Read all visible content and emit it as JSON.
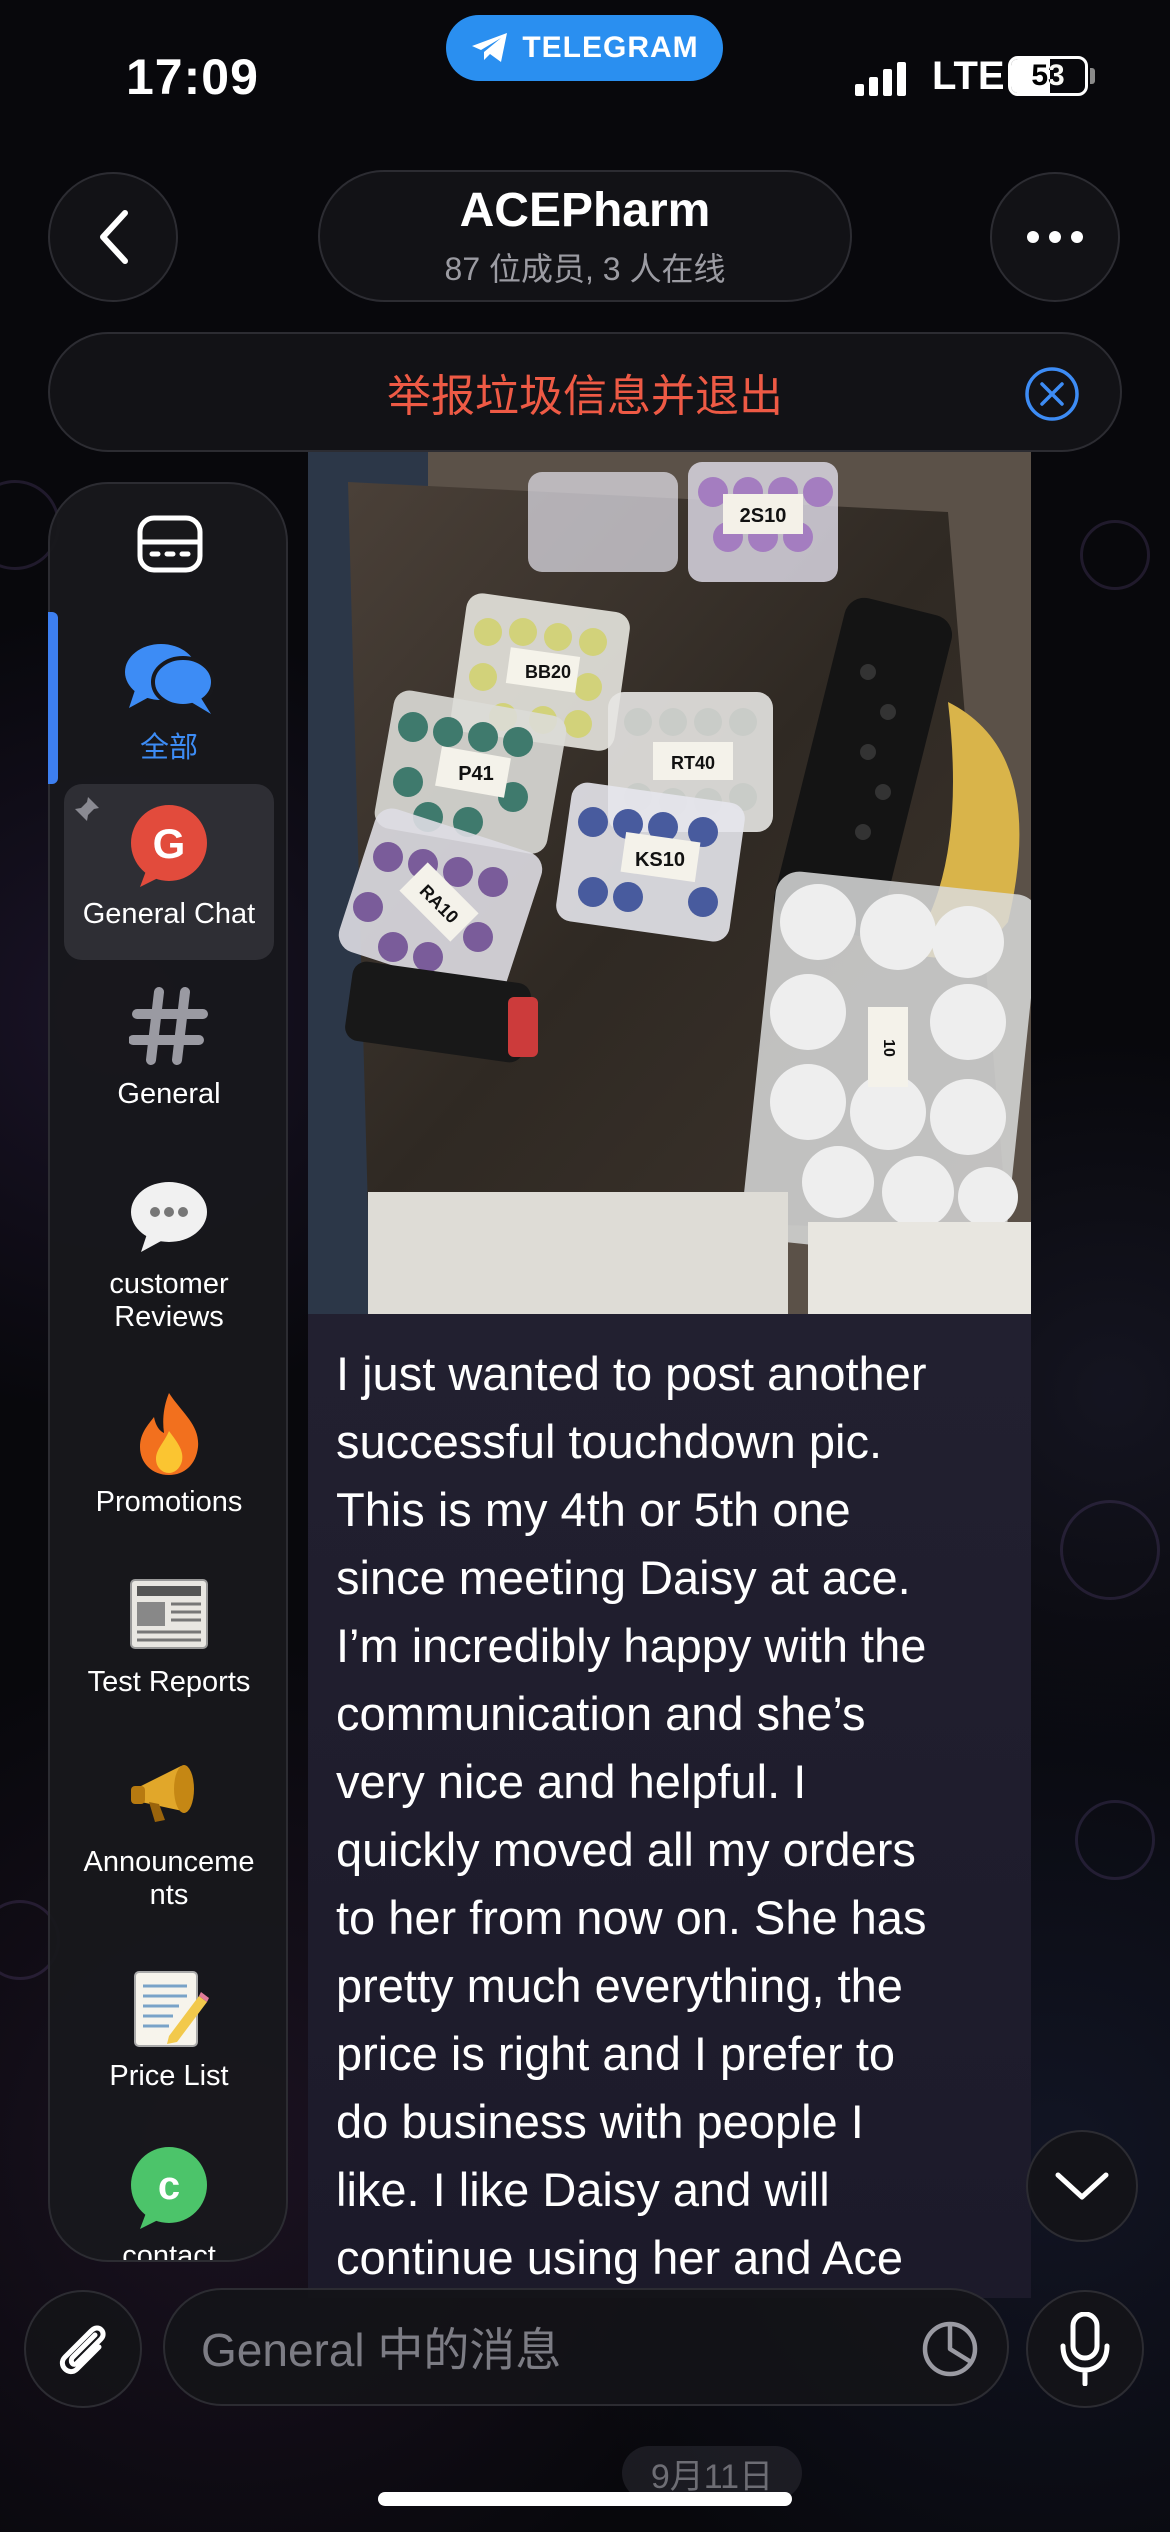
{
  "status_bar": {
    "time": "17:09",
    "app_pill": "TELEGRAM",
    "network": "LTE",
    "battery": "53",
    "battery_level": 0.53
  },
  "header": {
    "title": "ACEPharm",
    "subtitle": "87 位成员, 3 人在线",
    "back_icon": "chevron-left-icon",
    "more_icon": "more-dots-icon"
  },
  "report_bar": {
    "label": "举报垃圾信息并退出",
    "color": "#ee5a45"
  },
  "sidebar": {
    "items": [
      {
        "label": "全部",
        "icon": "chat-bubbles-icon",
        "active": true
      },
      {
        "label": "General Chat",
        "icon": "general-chat-g-icon",
        "selected": true,
        "pinned": true
      },
      {
        "label": "General",
        "icon": "hashtag-icon"
      },
      {
        "label": "customer\nReviews",
        "icon": "speech-bubble-icon"
      },
      {
        "label": "Promotions",
        "icon": "fire-icon"
      },
      {
        "label": "Test Reports",
        "icon": "newspaper-icon"
      },
      {
        "label": "Announceme\nnts",
        "icon": "megaphone-icon"
      },
      {
        "label": "Price List",
        "icon": "memo-icon"
      },
      {
        "label": "contact",
        "icon": "contact-c-icon"
      }
    ]
  },
  "message": {
    "photo_labels": [
      "2S10",
      "BB20",
      "RT40",
      "P41",
      "KS10",
      "RA10",
      "10"
    ],
    "text": "I just wanted to post another\nsuccessful touchdown pic.\nThis is my 4th or 5th one\nsince meeting Daisy at ace.\nI’m incredibly happy with the\ncommunication and she’s\nvery nice and helpful. I\nquickly moved all my orders\nto her from now on. She has\npretty much everything, the\nprice is right and I prefer to\ndo business with people I\nlike. I like Daisy and will\ncontinue using her and Ace"
  },
  "composer": {
    "placeholder": "General 中的消息"
  },
  "date_chip": "9月11日",
  "colors": {
    "accent_blue": "#3d8cf5",
    "telegram_blue": "#2a8ff0",
    "background": "#08080c"
  }
}
